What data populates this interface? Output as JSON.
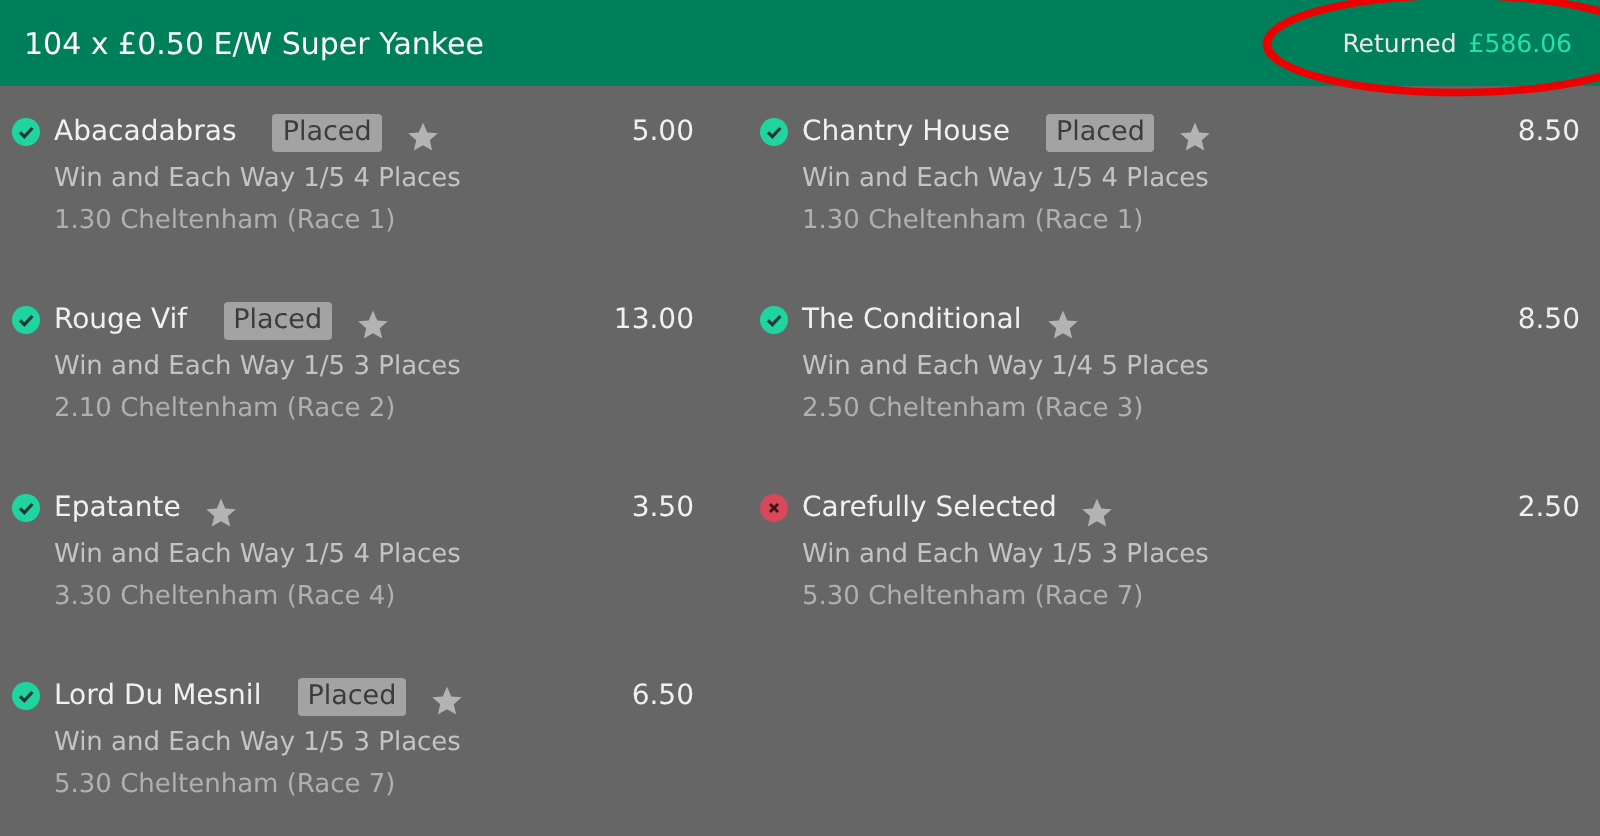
{
  "header": {
    "title": "104 x £0.50 E/W Super Yankee",
    "returned_label": "Returned",
    "returned_amount": "£586.06",
    "circled": true
  },
  "selections": [
    {
      "name": "Abacadabras",
      "placed": true,
      "won": true,
      "odds": "5.00",
      "market": "Win and Each Way 1/5 4 Places",
      "event": "1.30 Cheltenham (Race 1)",
      "placed_label": "Placed"
    },
    {
      "name": "Chantry House",
      "placed": true,
      "won": true,
      "odds": "8.50",
      "market": "Win and Each Way 1/5 4 Places",
      "event": "1.30 Cheltenham (Race 1)",
      "placed_label": "Placed"
    },
    {
      "name": "Rouge Vif",
      "placed": true,
      "won": true,
      "odds": "13.00",
      "market": "Win and Each Way 1/5 3 Places",
      "event": "2.10 Cheltenham (Race 2)",
      "placed_label": "Placed"
    },
    {
      "name": "The Conditional",
      "placed": false,
      "won": true,
      "odds": "8.50",
      "market": "Win and Each Way 1/4 5 Places",
      "event": "2.50 Cheltenham (Race 3)"
    },
    {
      "name": "Epatante",
      "placed": false,
      "won": true,
      "odds": "3.50",
      "market": "Win and Each Way 1/5 4 Places",
      "event": "3.30 Cheltenham (Race 4)"
    },
    {
      "name": "Carefully Selected",
      "placed": false,
      "won": false,
      "odds": "2.50",
      "market": "Win and Each Way 1/5 3 Places",
      "event": "5.30 Cheltenham (Race 7)"
    },
    {
      "name": "Lord Du Mesnil",
      "placed": true,
      "won": true,
      "odds": "6.50",
      "market": "Win and Each Way 1/5 3 Places",
      "event": "5.30 Cheltenham (Race 7)",
      "placed_label": "Placed"
    }
  ]
}
